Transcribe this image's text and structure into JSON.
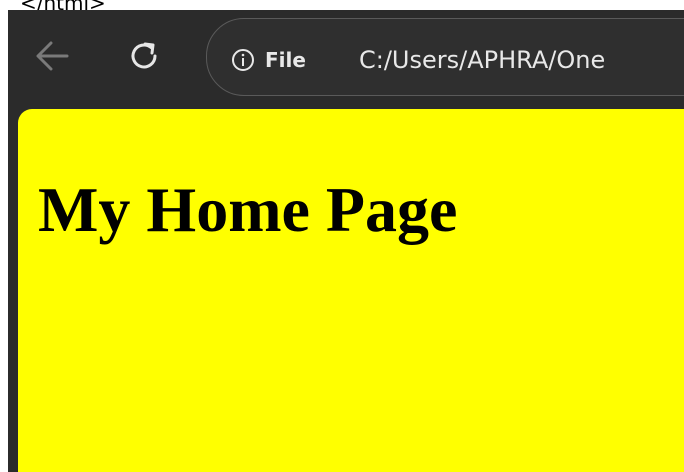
{
  "top_fragment": "</html>",
  "toolbar": {
    "back_icon": "arrow-left-icon",
    "reload_icon": "refresh-icon",
    "site_info_icon": "info-icon",
    "site_info_label": "File",
    "url": "C:/Users/APHRA/One"
  },
  "page": {
    "background_color": "#ffff00",
    "heading": "My Home Page"
  }
}
